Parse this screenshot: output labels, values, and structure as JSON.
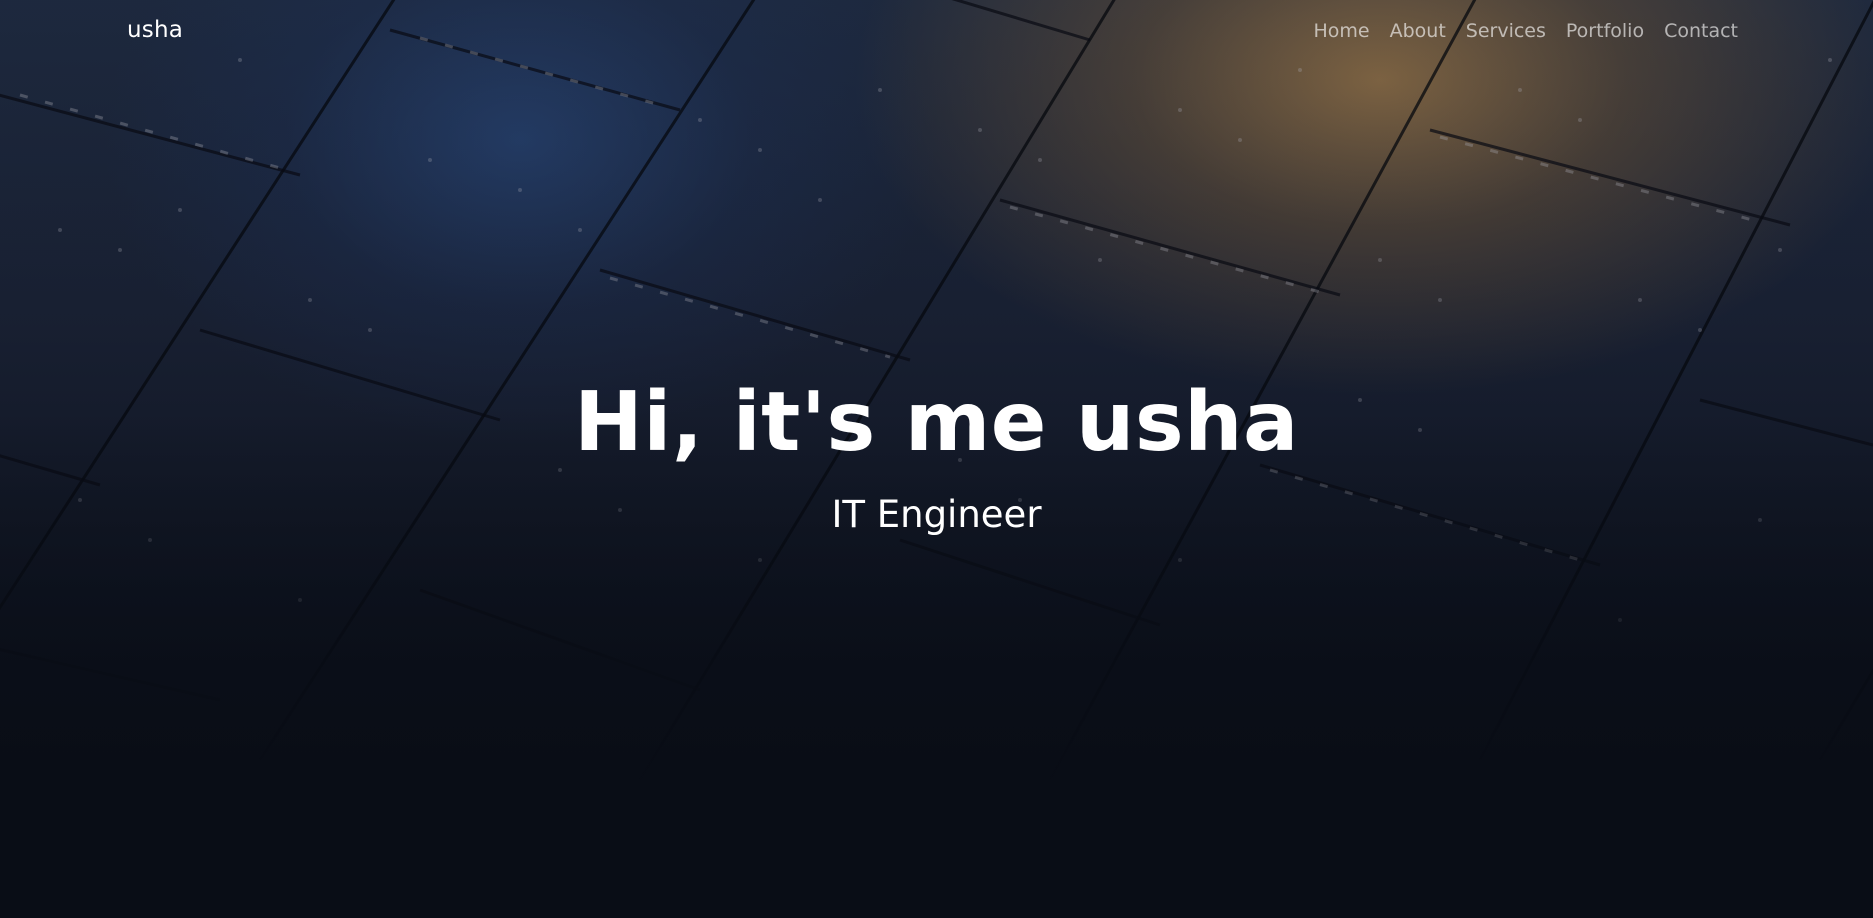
{
  "brand": "usha",
  "nav": {
    "items": [
      {
        "label": "Home"
      },
      {
        "label": "About"
      },
      {
        "label": "Services"
      },
      {
        "label": "Portfolio"
      },
      {
        "label": "Contact"
      }
    ]
  },
  "hero": {
    "title": "Hi, it's me usha",
    "subtitle": "IT Engineer"
  },
  "colors": {
    "text": "#ffffff",
    "nav_text": "#a5a8ad",
    "background_dark": "#0a0f1a",
    "panel_blue": "#1e3558",
    "panel_bronze": "#7a6040"
  }
}
